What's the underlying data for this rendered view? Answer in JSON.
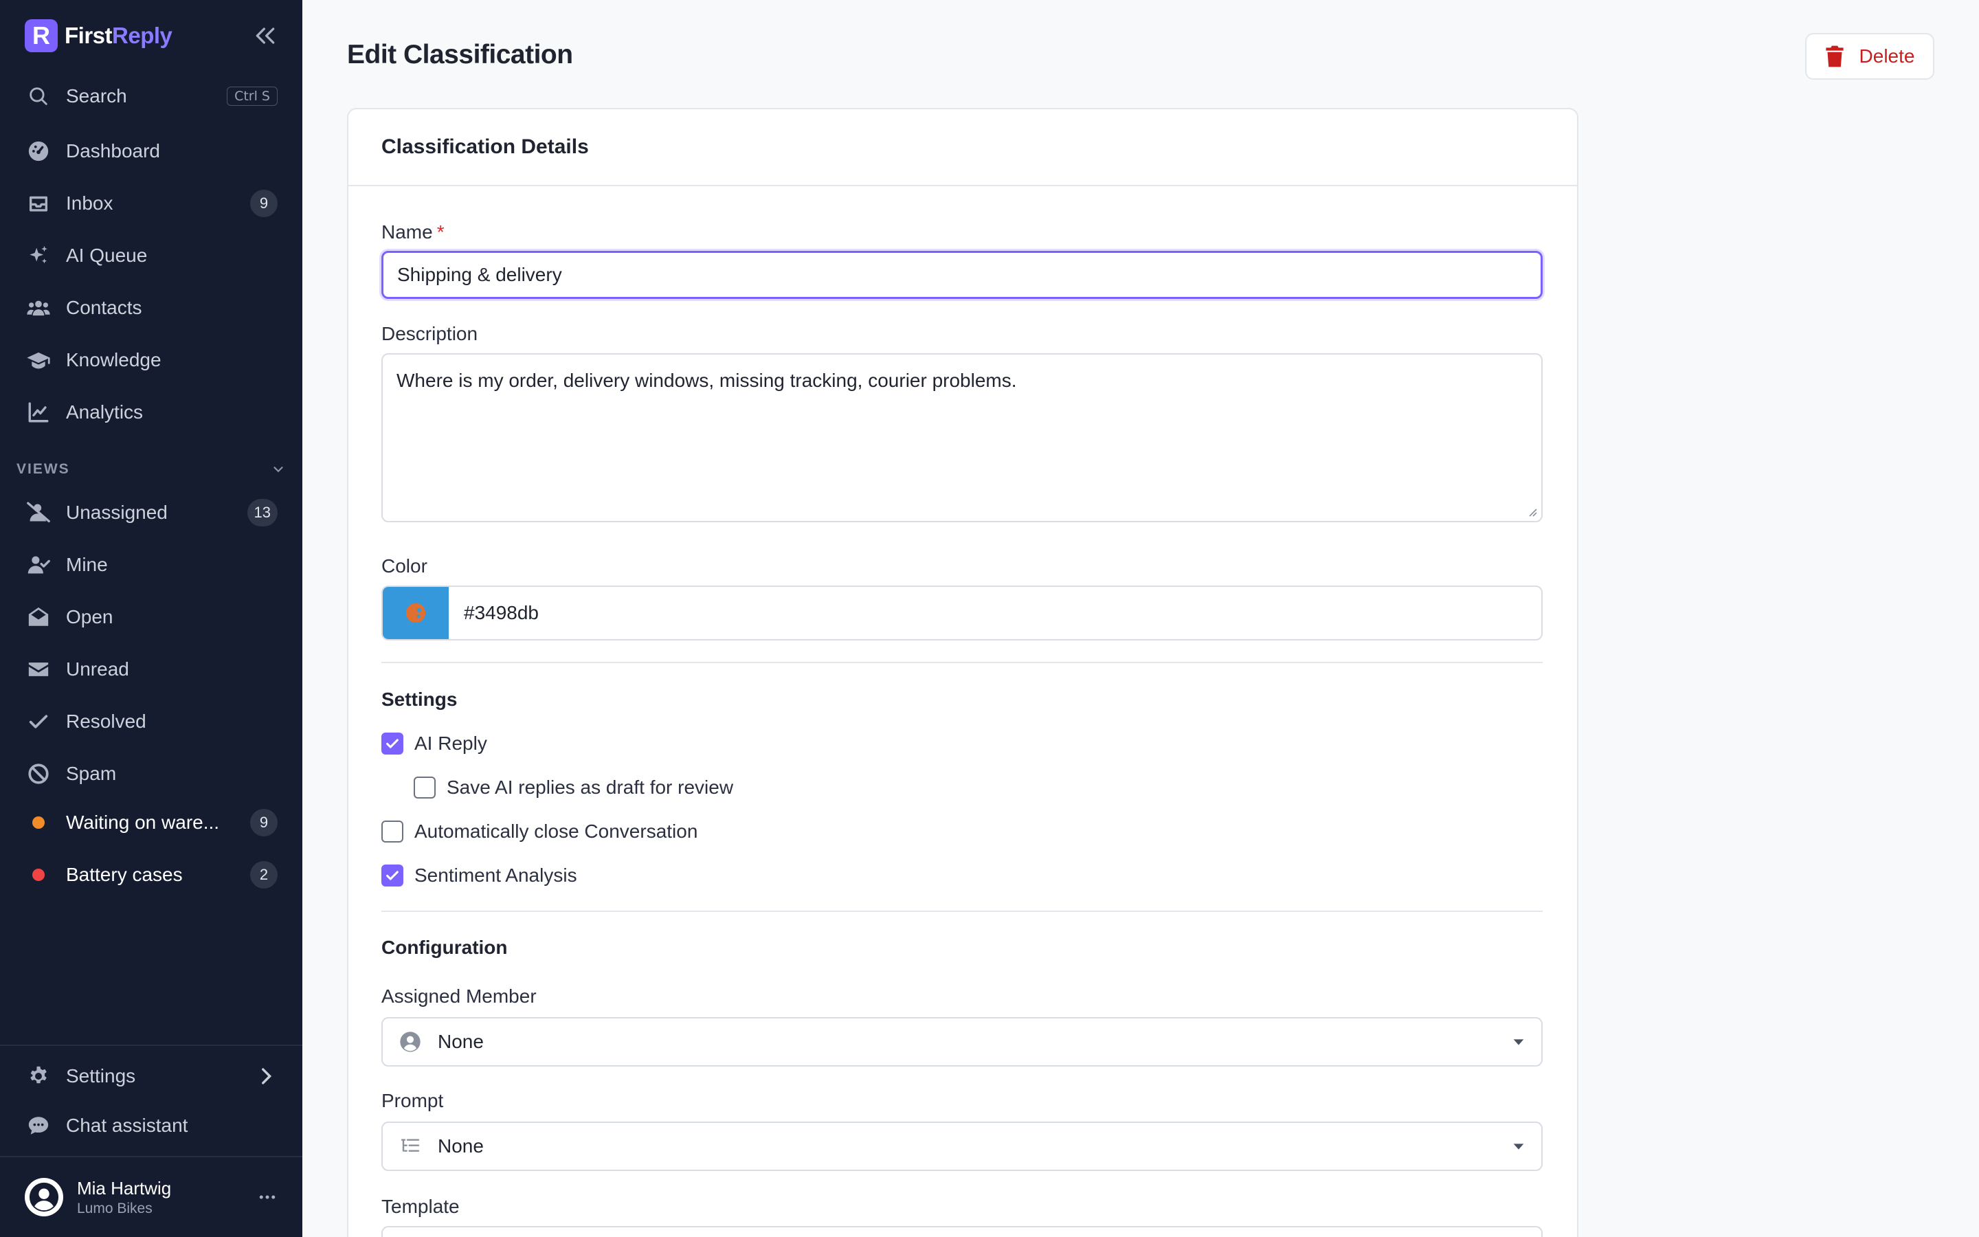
{
  "brand": {
    "mark": "R",
    "first": "First",
    "second": "Reply"
  },
  "search": {
    "label": "Search",
    "shortcut": "Ctrl S"
  },
  "nav": [
    {
      "label": "Dashboard",
      "icon": "gauge-icon"
    },
    {
      "label": "Inbox",
      "icon": "inbox-icon",
      "badge": "9"
    },
    {
      "label": "AI Queue",
      "icon": "sparkles-icon"
    },
    {
      "label": "Contacts",
      "icon": "users-icon"
    },
    {
      "label": "Knowledge",
      "icon": "graduation-cap-icon"
    },
    {
      "label": "Analytics",
      "icon": "chart-line-icon"
    }
  ],
  "views": {
    "header": "VIEWS",
    "items": [
      {
        "label": "Unassigned",
        "icon": "user-slash-icon",
        "badge": "13"
      },
      {
        "label": "Mine",
        "icon": "user-check-icon"
      },
      {
        "label": "Open",
        "icon": "envelope-open-icon"
      },
      {
        "label": "Unread",
        "icon": "envelope-icon"
      },
      {
        "label": "Resolved",
        "icon": "check-icon"
      },
      {
        "label": "Spam",
        "icon": "ban-icon"
      },
      {
        "label": "Waiting on ware...",
        "dot_color": "#f28c28",
        "badge": "9"
      },
      {
        "label": "Battery cases",
        "dot_color": "#ef4444",
        "badge": "2"
      }
    ]
  },
  "footer_nav": {
    "settings": "Settings",
    "chat_assistant": "Chat assistant"
  },
  "user": {
    "name": "Mia Hartwig",
    "org": "Lumo Bikes"
  },
  "page": {
    "title": "Edit Classification",
    "delete_label": "Delete",
    "card_title": "Classification Details"
  },
  "form": {
    "name_label": "Name",
    "required_mark": "*",
    "name_value": "Shipping & delivery",
    "description_label": "Description",
    "description_value": "Where is my order, delivery windows, missing tracking, courier problems.",
    "color_label": "Color",
    "color_value": "#3498db",
    "settings_title": "Settings",
    "ai_reply_label": "AI Reply",
    "ai_reply_checked": true,
    "draft_label": "Save AI replies as draft for review",
    "draft_checked": false,
    "auto_close_label": "Automatically close Conversation",
    "auto_close_checked": false,
    "sentiment_label": "Sentiment Analysis",
    "sentiment_checked": true,
    "configuration_title": "Configuration",
    "assigned_member_label": "Assigned Member",
    "assigned_member_value": "None",
    "prompt_label": "Prompt",
    "prompt_value": "None",
    "template_label": "Template"
  },
  "colors": {
    "sidebar_bg": "#161c2f",
    "accent": "#7b61ff",
    "danger": "#c81e1e",
    "swatch": "#3498db"
  }
}
